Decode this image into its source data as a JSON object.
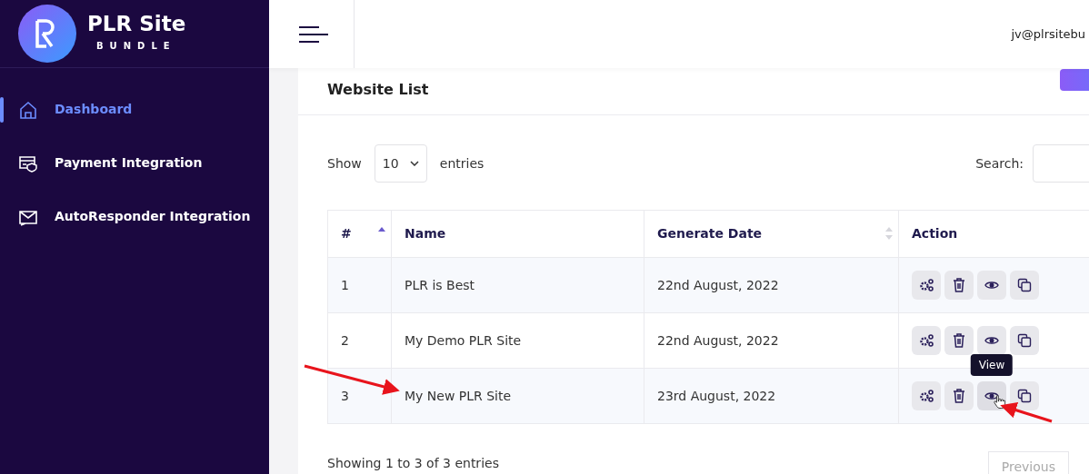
{
  "brand": {
    "name": "PLR Site",
    "tagline": "BUNDLE"
  },
  "sidebar": {
    "items": [
      {
        "label": "Dashboard",
        "kind": "home",
        "selected": true
      },
      {
        "label": "Payment Integration",
        "kind": "payment",
        "selected": false
      },
      {
        "label": "AutoResponder Integration",
        "kind": "mail",
        "selected": false
      }
    ]
  },
  "header": {
    "user_email": "jv@plrsitebu"
  },
  "card": {
    "title": "Website List",
    "length_menu": {
      "before": "Show",
      "value": "10",
      "after": "entries"
    },
    "search": {
      "label": "Search:"
    },
    "table": {
      "columns": [
        {
          "label": "#",
          "sorted": true
        },
        {
          "label": "Name"
        },
        {
          "label": "Generate Date",
          "sorted": false
        },
        {
          "label": "Action"
        }
      ],
      "rows": [
        {
          "cells": [
            "1",
            "PLR is Best",
            "22nd August, 2022"
          ],
          "actions": [
            {
              "kind": "settings",
              "hovered": false
            },
            {
              "kind": "delete",
              "hovered": false
            },
            {
              "kind": "view",
              "hovered": false
            },
            {
              "kind": "copy",
              "hovered": false
            }
          ]
        },
        {
          "cells": [
            "2",
            "My Demo PLR Site",
            "22nd August, 2022"
          ],
          "actions": [
            {
              "kind": "settings",
              "hovered": false
            },
            {
              "kind": "delete",
              "hovered": false
            },
            {
              "kind": "view",
              "hovered": false
            },
            {
              "kind": "copy",
              "hovered": false
            }
          ]
        },
        {
          "cells": [
            "3",
            "My New PLR Site",
            "23rd August, 2022"
          ],
          "actions": [
            {
              "kind": "settings",
              "hovered": false
            },
            {
              "kind": "delete",
              "hovered": false
            },
            {
              "kind": "view",
              "hovered": true,
              "tooltip": "View"
            },
            {
              "kind": "copy",
              "hovered": false
            }
          ]
        }
      ]
    },
    "info": "Showing 1 to 3 of 3 entries",
    "pagination": [
      "Previous"
    ]
  },
  "annotation_arrows": [
    {
      "kind": "arrow"
    },
    {
      "kind": "arrow"
    }
  ]
}
